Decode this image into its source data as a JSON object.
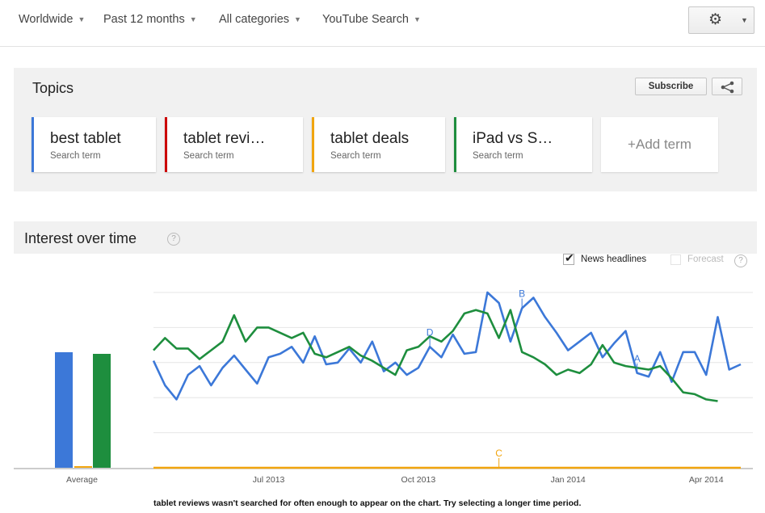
{
  "filters": [
    {
      "label": "Worldwide"
    },
    {
      "label": "Past 12 months"
    },
    {
      "label": "All categories"
    },
    {
      "label": "YouTube Search"
    }
  ],
  "topics": {
    "title": "Topics",
    "subscribe_label": "Subscribe",
    "add_term_label": "+Add term",
    "terms": [
      {
        "name": "best tablet",
        "sub": "Search term",
        "color": "#3c78d8"
      },
      {
        "name": "tablet revi…",
        "sub": "Search term",
        "color": "#cc0000"
      },
      {
        "name": "tablet deals",
        "sub": "Search term",
        "color": "#f1a50f"
      },
      {
        "name": "iPad vs S…",
        "sub": "Search term",
        "color": "#1e8e3e"
      }
    ]
  },
  "interest": {
    "title": "Interest over time",
    "help_glyph": "?",
    "news_label": "News headlines",
    "news_checked": true,
    "forecast_label": "Forecast",
    "forecast_checked": false,
    "average_label": "Average",
    "footnote": "tablet reviews wasn't searched for often enough to appear on the chart. Try selecting a longer time period."
  },
  "chart_data": {
    "type": "line",
    "x_tick_labels": [
      "Jul 2013",
      "Oct 2013",
      "Jan 2014",
      "Apr 2014"
    ],
    "annotations": [
      {
        "letter": "A",
        "week_index": 42,
        "series": "best tablet"
      },
      {
        "letter": "B",
        "week_index": 32,
        "series": "best tablet"
      },
      {
        "letter": "C",
        "week_index": 30,
        "series": "tablet deals"
      },
      {
        "letter": "D",
        "week_index": 24,
        "series": "best tablet"
      }
    ],
    "grid": true,
    "ylim": [
      0,
      100
    ],
    "series": [
      {
        "name": "best tablet",
        "color": "#3c78d8",
        "average": 66,
        "values": [
          61,
          47,
          39,
          53,
          58,
          47,
          57,
          64,
          56,
          48,
          63,
          65,
          69,
          60,
          75,
          59,
          60,
          68,
          60,
          72,
          55,
          60,
          53,
          57,
          69,
          63,
          76,
          65,
          66,
          100,
          94,
          72,
          91,
          97,
          86,
          77,
          67,
          72,
          77,
          63,
          71,
          78,
          54,
          52,
          66,
          49,
          66,
          66,
          53,
          86,
          56,
          59
        ]
      },
      {
        "name": "tablet reviews",
        "color": "#cc0000",
        "average": 0,
        "values": []
      },
      {
        "name": "tablet deals",
        "color": "#f1a50f",
        "average": 0,
        "values": [
          0,
          0,
          0,
          0,
          0,
          0,
          0,
          0,
          0,
          0,
          0,
          0,
          0,
          0,
          0,
          0,
          0,
          0,
          0,
          0,
          0,
          0,
          0,
          0,
          0,
          0,
          0,
          0,
          0,
          0,
          0,
          0,
          0,
          0,
          0,
          0,
          0,
          0,
          0,
          0,
          0,
          0,
          0,
          0,
          0,
          0,
          0,
          0,
          0,
          0,
          0,
          0
        ]
      },
      {
        "name": "iPad vs S…",
        "color": "#1e8e3e",
        "average": 65,
        "values": [
          67,
          74,
          68,
          68,
          62,
          67,
          72,
          87,
          72,
          80,
          80,
          77,
          74,
          77,
          65,
          63,
          66,
          69,
          64,
          61,
          57,
          53,
          67,
          69,
          75,
          72,
          78,
          88,
          90,
          88,
          74,
          90,
          66,
          63,
          59,
          53,
          56,
          54,
          59,
          70,
          60,
          58,
          57,
          56,
          58,
          51,
          43,
          42,
          39,
          38
        ]
      }
    ]
  }
}
